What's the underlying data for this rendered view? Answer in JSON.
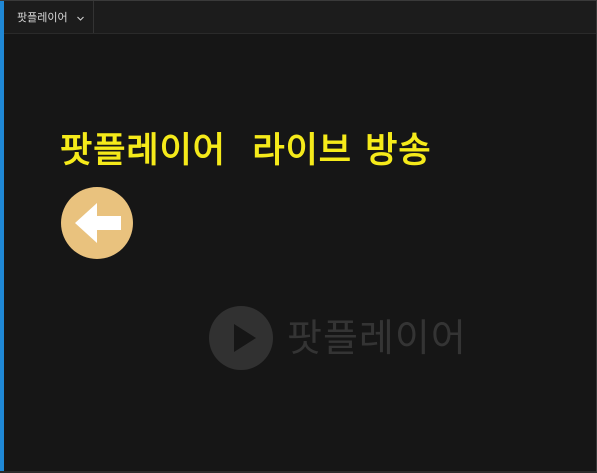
{
  "tab": {
    "label": "팟플레이어",
    "dropdown_icon": "chevron-down-icon"
  },
  "content": {
    "title": "팟플레이어  라이브 방송",
    "back_icon": "arrow-left-icon",
    "watermark_text": "팟플레이어",
    "watermark_icon": "play-icon"
  },
  "colors": {
    "title": "#f5ea1a",
    "back_button": "#e9c27e",
    "accent": "#1f88d6",
    "background": "#161616"
  }
}
